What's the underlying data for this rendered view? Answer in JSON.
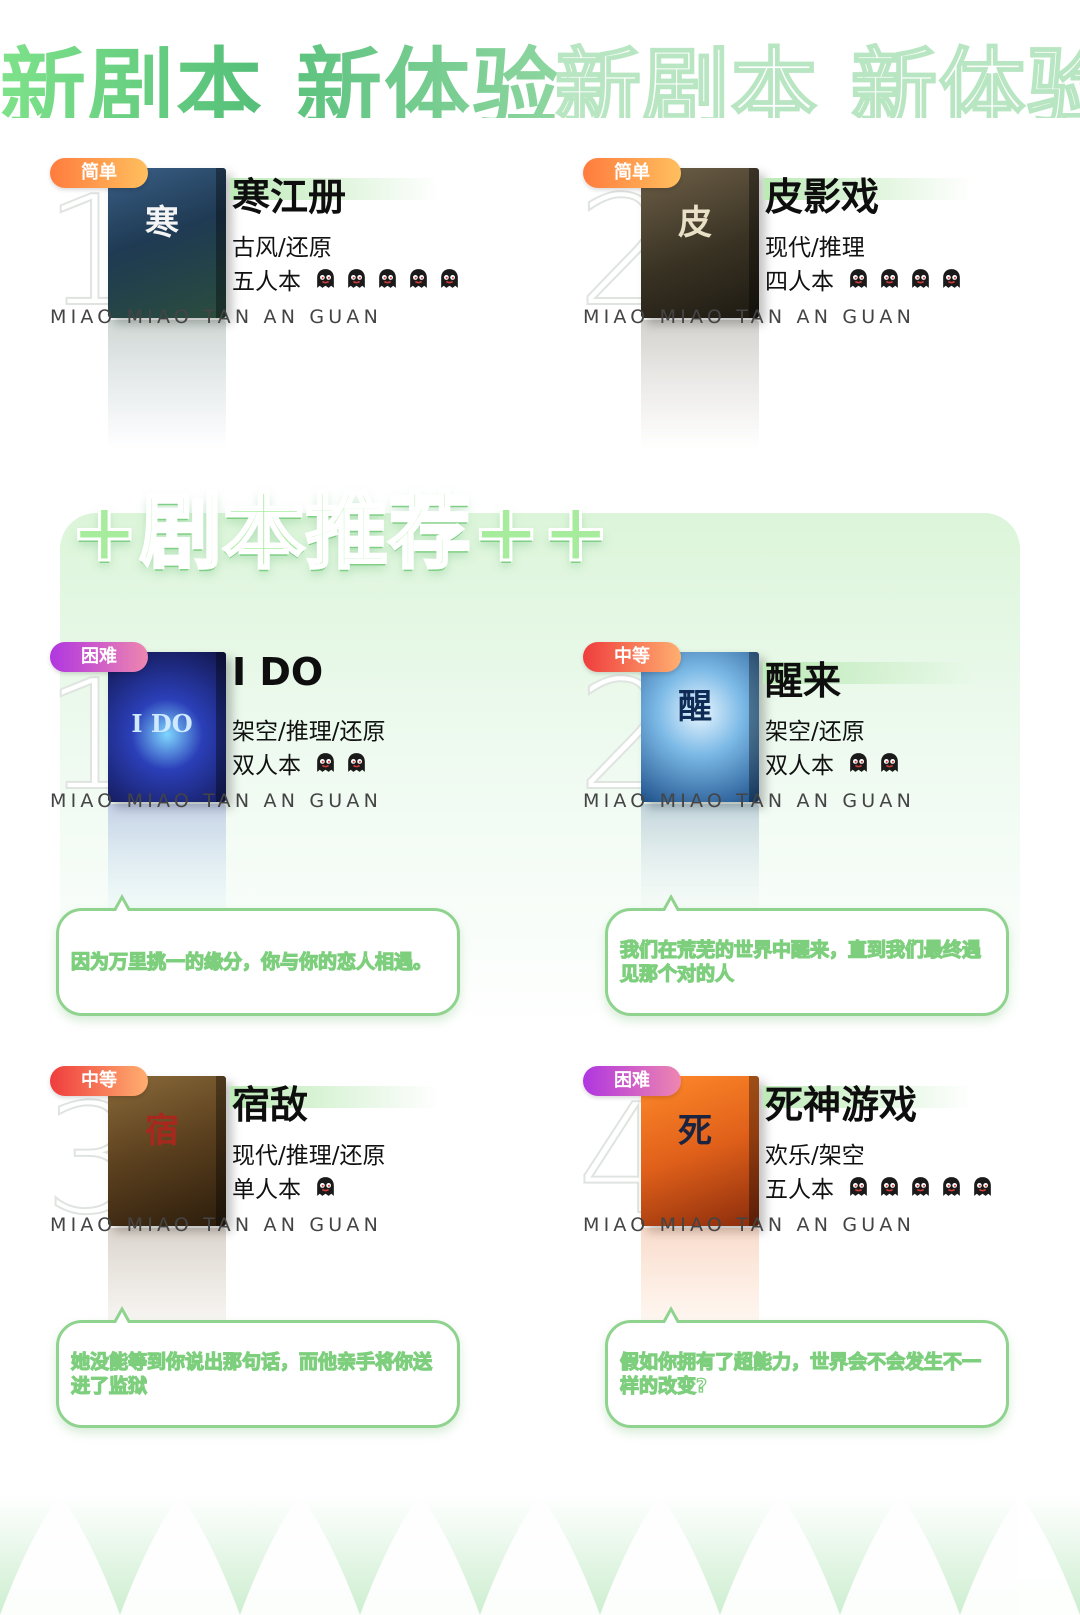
{
  "header": {
    "title": "新剧本 新体验",
    "title_ghost": "新剧本 新体验"
  },
  "section": {
    "title": "+剧本推荐++"
  },
  "brand": "MIAO MIAO TAN AN GUAN",
  "colors": {
    "accent_green": "#8fd38f",
    "easy": "#ff9a4a",
    "medium": "#f05a4a",
    "hard": "#c24fe0"
  },
  "new_scripts": [
    {
      "rank": "1",
      "difficulty": "简单",
      "name": "寒江册",
      "genre": "古风/还原",
      "players": "五人本",
      "ghost_count": 5,
      "cover_text": "寒"
    },
    {
      "rank": "2",
      "difficulty": "简单",
      "name": "皮影戏",
      "genre": "现代/推理",
      "players": "四人本",
      "ghost_count": 4,
      "cover_text": "皮"
    }
  ],
  "recommended": [
    {
      "rank": "1",
      "difficulty": "困难",
      "name": "I DO",
      "genre": "架空/推理/还原",
      "players": "双人本",
      "ghost_count": 2,
      "cover_text": "I DO",
      "blurb": "因为万里挑一的缘分，你与你的恋人相遇。"
    },
    {
      "rank": "2",
      "difficulty": "中等",
      "name": "醒来",
      "genre": "架空/还原",
      "players": "双人本",
      "ghost_count": 2,
      "cover_text": "醒",
      "blurb": "我们在荒芜的世界中醒来，直到我们最终遇见那个对的人"
    },
    {
      "rank": "3",
      "difficulty": "中等",
      "name": "宿敌",
      "genre": "现代/推理/还原",
      "players": "单人本",
      "ghost_count": 1,
      "cover_text": "宿",
      "blurb": "她没能等到你说出那句话，而他亲手将你送进了监狱"
    },
    {
      "rank": "4",
      "difficulty": "困难",
      "name": "死神游戏",
      "genre": "欢乐/架空",
      "players": "五人本",
      "ghost_count": 5,
      "cover_text": "死",
      "blurb": "假如你拥有了超能力，世界会不会发生不一样的改变?"
    }
  ],
  "icons": {
    "difficulty_badge": "pill-badge",
    "player_marker": "ghost-icon"
  }
}
